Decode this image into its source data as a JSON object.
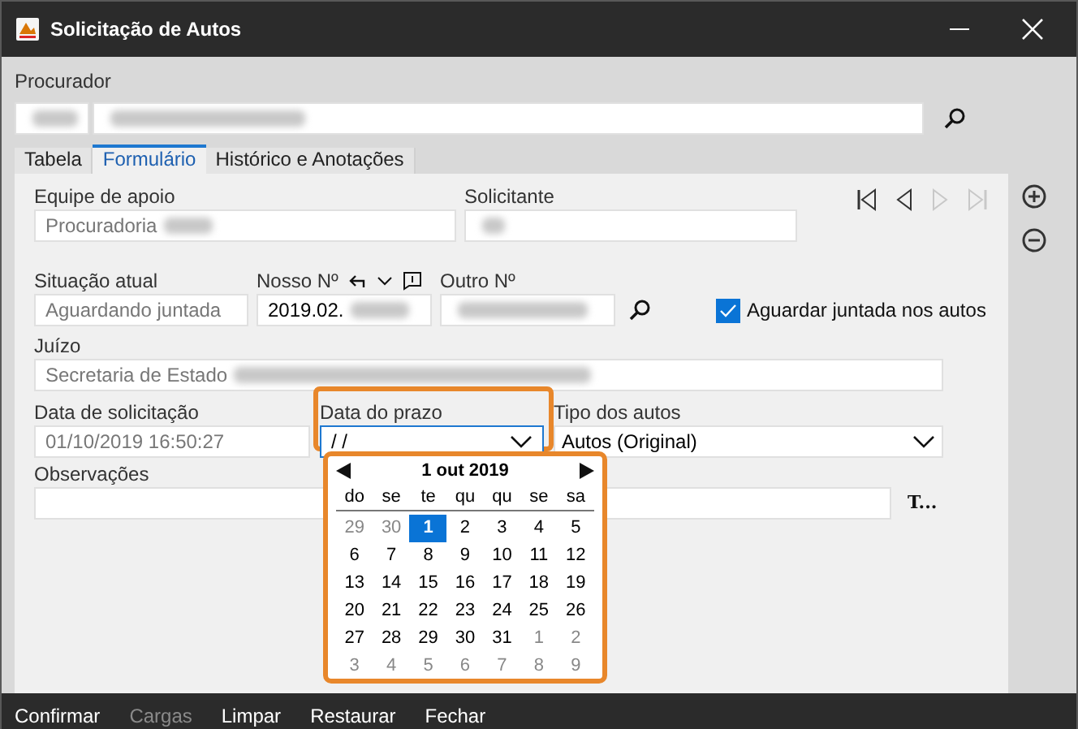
{
  "window": {
    "title": "Solicitação de Autos"
  },
  "procurador": {
    "label": "Procurador",
    "code_redacted": true,
    "name_redacted": true
  },
  "tabs": [
    {
      "label": "Tabela",
      "selected": false
    },
    {
      "label": "Formulário",
      "selected": true
    },
    {
      "label": "Histórico e Anotações",
      "selected": false
    }
  ],
  "form": {
    "equipe": {
      "label": "Equipe de apoio",
      "value": "Procuradoria",
      "redacted": true
    },
    "solicitante": {
      "label": "Solicitante",
      "redacted": true
    },
    "situacao": {
      "label": "Situação atual",
      "value": "Aguardando juntada"
    },
    "nosso_numero": {
      "label": "Nosso Nº",
      "value": "2019.02.",
      "redacted": true
    },
    "outro_numero": {
      "label": "Outro Nº",
      "redacted": true
    },
    "aguardar": {
      "label": "Aguardar juntada nos autos",
      "checked": true
    },
    "juizo": {
      "label": "Juízo",
      "value": "Secretaria de Estado",
      "redacted": true
    },
    "data_solicitacao": {
      "label": "Data de solicitação",
      "value": "01/10/2019 16:50:27"
    },
    "data_prazo": {
      "label": "Data do prazo",
      "value": "/ /"
    },
    "tipo_autos": {
      "label": "Tipo dos autos",
      "value": "Autos (Original)"
    },
    "observacoes": {
      "label": "Observações"
    },
    "text_button": "T..."
  },
  "record_nav": [
    {
      "kind": "first",
      "disabled": false
    },
    {
      "kind": "previous",
      "disabled": false
    },
    {
      "kind": "next",
      "disabled": true
    },
    {
      "kind": "last",
      "disabled": true
    }
  ],
  "calendar": {
    "month": "1 out 2019",
    "weekdays": [
      "do",
      "se",
      "te",
      "qu",
      "qu",
      "se",
      "sa"
    ],
    "days": [
      {
        "label": "29",
        "current_month": false,
        "selected": false
      },
      {
        "label": "30",
        "current_month": false,
        "selected": false
      },
      {
        "label": "1",
        "current_month": true,
        "selected": true
      },
      {
        "label": "2",
        "current_month": true,
        "selected": false
      },
      {
        "label": "3",
        "current_month": true,
        "selected": false
      },
      {
        "label": "4",
        "current_month": true,
        "selected": false
      },
      {
        "label": "5",
        "current_month": true,
        "selected": false
      },
      {
        "label": "6",
        "current_month": true,
        "selected": false
      },
      {
        "label": "7",
        "current_month": true,
        "selected": false
      },
      {
        "label": "8",
        "current_month": true,
        "selected": false
      },
      {
        "label": "9",
        "current_month": true,
        "selected": false
      },
      {
        "label": "10",
        "current_month": true,
        "selected": false
      },
      {
        "label": "11",
        "current_month": true,
        "selected": false
      },
      {
        "label": "12",
        "current_month": true,
        "selected": false
      },
      {
        "label": "13",
        "current_month": true,
        "selected": false
      },
      {
        "label": "14",
        "current_month": true,
        "selected": false
      },
      {
        "label": "15",
        "current_month": true,
        "selected": false
      },
      {
        "label": "16",
        "current_month": true,
        "selected": false
      },
      {
        "label": "17",
        "current_month": true,
        "selected": false
      },
      {
        "label": "18",
        "current_month": true,
        "selected": false
      },
      {
        "label": "19",
        "current_month": true,
        "selected": false
      },
      {
        "label": "20",
        "current_month": true,
        "selected": false
      },
      {
        "label": "21",
        "current_month": true,
        "selected": false
      },
      {
        "label": "22",
        "current_month": true,
        "selected": false
      },
      {
        "label": "23",
        "current_month": true,
        "selected": false
      },
      {
        "label": "24",
        "current_month": true,
        "selected": false
      },
      {
        "label": "25",
        "current_month": true,
        "selected": false
      },
      {
        "label": "26",
        "current_month": true,
        "selected": false
      },
      {
        "label": "27",
        "current_month": true,
        "selected": false
      },
      {
        "label": "28",
        "current_month": true,
        "selected": false
      },
      {
        "label": "29",
        "current_month": true,
        "selected": false
      },
      {
        "label": "30",
        "current_month": true,
        "selected": false
      },
      {
        "label": "31",
        "current_month": true,
        "selected": false
      },
      {
        "label": "1",
        "current_month": false,
        "selected": false
      },
      {
        "label": "2",
        "current_month": false,
        "selected": false
      },
      {
        "label": "3",
        "current_month": false,
        "selected": false
      },
      {
        "label": "4",
        "current_month": false,
        "selected": false
      },
      {
        "label": "5",
        "current_month": false,
        "selected": false
      },
      {
        "label": "6",
        "current_month": false,
        "selected": false
      },
      {
        "label": "7",
        "current_month": false,
        "selected": false
      },
      {
        "label": "8",
        "current_month": false,
        "selected": false
      },
      {
        "label": "9",
        "current_month": false,
        "selected": false
      }
    ]
  },
  "buttons": [
    {
      "label": "Confirmar",
      "disabled": false
    },
    {
      "label": "Cargas",
      "disabled": true
    },
    {
      "label": "Limpar",
      "disabled": false
    },
    {
      "label": "Restaurar",
      "disabled": false
    },
    {
      "label": "Fechar",
      "disabled": false
    }
  ]
}
